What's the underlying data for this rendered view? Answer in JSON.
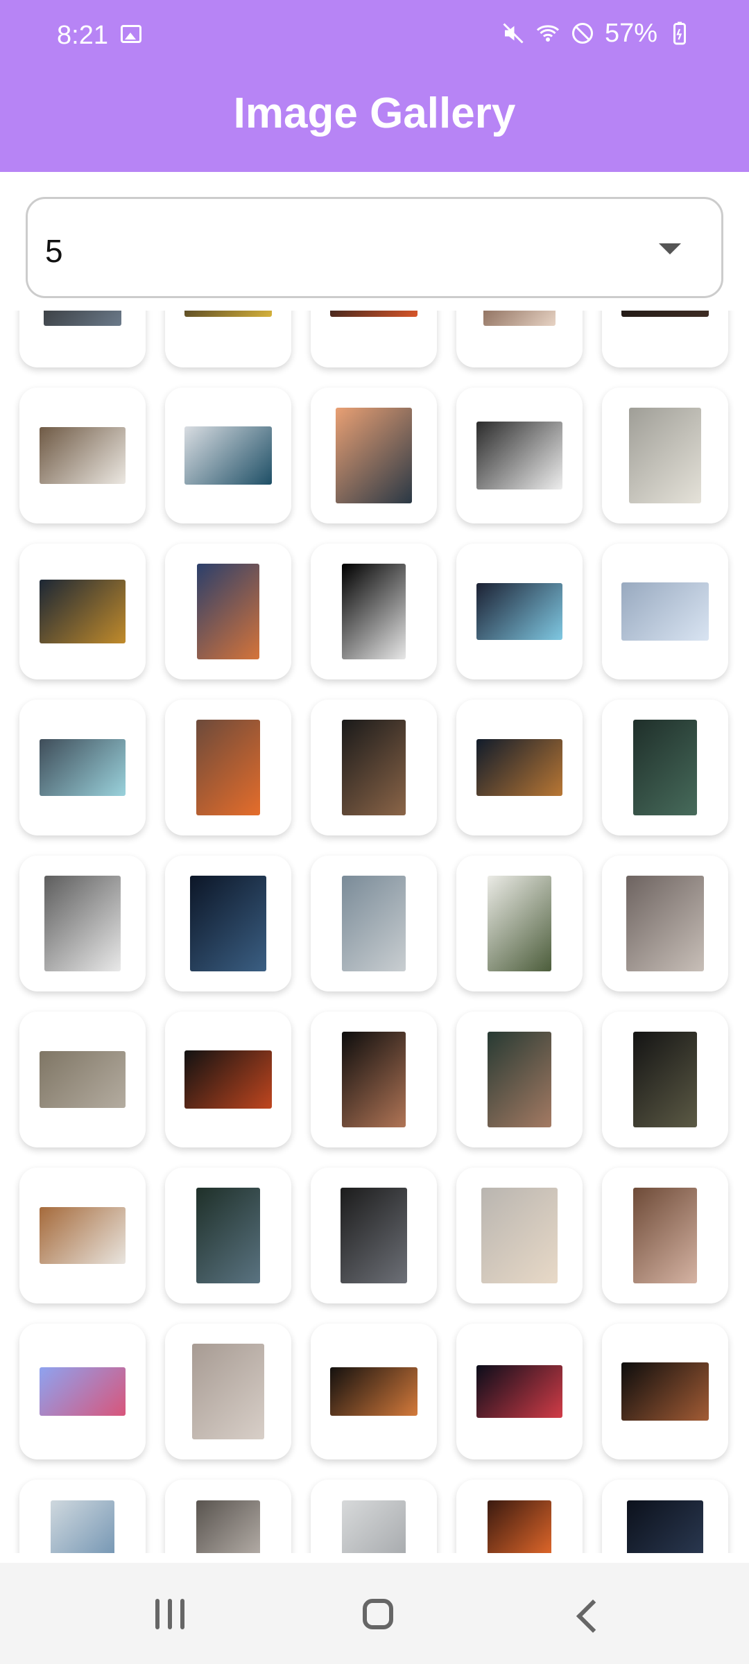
{
  "status_bar": {
    "time": "8:21",
    "battery": "57%",
    "icons": [
      "gallery-icon",
      "mute-icon",
      "wifi-icon",
      "do-not-disturb-icon",
      "battery-icon"
    ]
  },
  "app_bar": {
    "title": "Image Gallery"
  },
  "dropdown": {
    "selected_value": "5",
    "icon": "chevron-down-icon"
  },
  "grid": {
    "columns": 5,
    "thumbnails": [
      {
        "colors": [
          "#2b2b2b",
          "#6b7a8a"
        ]
      },
      {
        "colors": [
          "#3a3020",
          "#d6b23b"
        ]
      },
      {
        "colors": [
          "#1b1b1b",
          "#d9562a"
        ]
      },
      {
        "colors": [
          "#6f4c3a",
          "#e7d3c4"
        ]
      },
      {
        "colors": [
          "#1b1613",
          "#3f2d24"
        ]
      },
      {
        "colors": [
          "#6f5a45",
          "#ece8e2"
        ]
      },
      {
        "colors": [
          "#d9dde2",
          "#1e4f66"
        ]
      },
      {
        "colors": [
          "#e9a074",
          "#2a3845"
        ]
      },
      {
        "colors": [
          "#2b2b2b",
          "#eeeeee"
        ]
      },
      {
        "colors": [
          "#9f9e97",
          "#e5e2d9"
        ]
      },
      {
        "colors": [
          "#1c2735",
          "#c18b2b"
        ]
      },
      {
        "colors": [
          "#2b3f6b",
          "#d5743a"
        ]
      },
      {
        "colors": [
          "#000000",
          "#e8e8e8"
        ]
      },
      {
        "colors": [
          "#1c2133",
          "#7fc8e2"
        ]
      },
      {
        "colors": [
          "#98a9bf",
          "#d9e4f2"
        ]
      },
      {
        "colors": [
          "#3f4d59",
          "#9ad2dc"
        ]
      },
      {
        "colors": [
          "#6c4a3b",
          "#e56d2b"
        ]
      },
      {
        "colors": [
          "#1a1a1a",
          "#8b6548"
        ]
      },
      {
        "colors": [
          "#111c2b",
          "#b97734"
        ]
      },
      {
        "colors": [
          "#1f2f2a",
          "#476b5b"
        ]
      },
      {
        "colors": [
          "#5d5d5d",
          "#e9e9e9"
        ]
      },
      {
        "colors": [
          "#0c1627",
          "#3b5f83"
        ]
      },
      {
        "colors": [
          "#7a8b98",
          "#c9ced1"
        ]
      },
      {
        "colors": [
          "#ebebe6",
          "#4c5d3b"
        ]
      },
      {
        "colors": [
          "#6d6360",
          "#c8bfb8"
        ]
      },
      {
        "colors": [
          "#7f7665",
          "#b4aca0"
        ]
      },
      {
        "colors": [
          "#121212",
          "#c0461f"
        ]
      },
      {
        "colors": [
          "#0d0d0d",
          "#b17556"
        ]
      },
      {
        "colors": [
          "#273a33",
          "#a47a63"
        ]
      },
      {
        "colors": [
          "#141414",
          "#5c5a45"
        ]
      },
      {
        "colors": [
          "#a56a3b",
          "#e9e5df"
        ]
      },
      {
        "colors": [
          "#1f3029",
          "#5a7381"
        ]
      },
      {
        "colors": [
          "#1c1c1c",
          "#6d7077"
        ]
      },
      {
        "colors": [
          "#b9b5b0",
          "#e8d9c7"
        ]
      },
      {
        "colors": [
          "#6e4b38",
          "#d5b3a3"
        ]
      },
      {
        "colors": [
          "#8ea3f0",
          "#d8557a"
        ]
      },
      {
        "colors": [
          "#a79b93",
          "#d8cfc8"
        ]
      },
      {
        "colors": [
          "#14110f",
          "#d47a3b"
        ]
      },
      {
        "colors": [
          "#0b0d1a",
          "#d23c47"
        ]
      },
      {
        "colors": [
          "#0d0d0d",
          "#a35c35"
        ]
      },
      {
        "colors": [
          "#cfd8de",
          "#7697b4"
        ]
      },
      {
        "colors": [
          "#59544f",
          "#b3aca6"
        ]
      },
      {
        "colors": [
          "#d7d9da",
          "#a8abae"
        ]
      },
      {
        "colors": [
          "#3a1a10",
          "#e0672a"
        ]
      },
      {
        "colors": [
          "#0c111c",
          "#2a3850"
        ]
      }
    ]
  }
}
